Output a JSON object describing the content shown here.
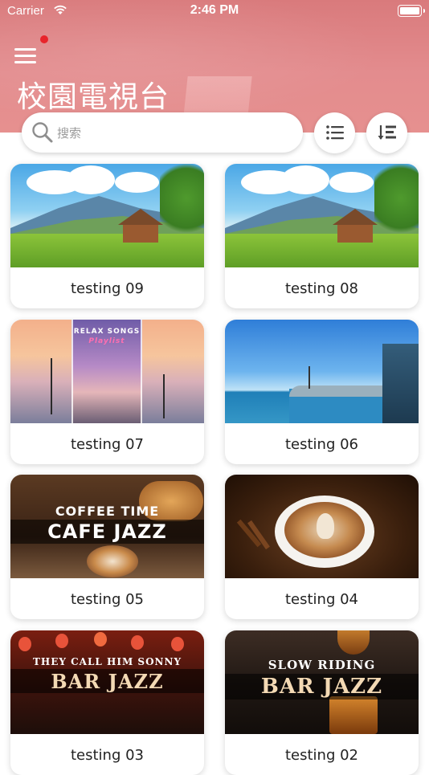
{
  "status_bar": {
    "carrier": "Carrier",
    "time": "2:46 PM"
  },
  "header": {
    "title": "校園電視台",
    "has_notification": true
  },
  "search": {
    "placeholder": "搜索",
    "value": ""
  },
  "toolbar": {
    "list_view_icon": "list-icon",
    "sort_icon": "sort-icon"
  },
  "videos": [
    {
      "label": "testing 09",
      "thumbnail": "countryside-house"
    },
    {
      "label": "testing 08",
      "thumbnail": "countryside-house"
    },
    {
      "label": "testing 07",
      "thumbnail": "relax-songs-sunset"
    },
    {
      "label": "testing 06",
      "thumbnail": "seaside"
    },
    {
      "label": "testing 05",
      "thumbnail": "cafe-jazz"
    },
    {
      "label": "testing 04",
      "thumbnail": "latte-art"
    },
    {
      "label": "testing 03",
      "thumbnail": "bar-jazz-lanterns"
    },
    {
      "label": "testing 02",
      "thumbnail": "bar-jazz-whiskey"
    }
  ],
  "thumbnail_text": {
    "relax_title": "RELAX SONGS",
    "relax_subtitle": "Playlist",
    "cafe_top": "COFFEE TIME",
    "cafe_main": "CAFE JAZZ",
    "bar1_top": "THEY CALL HIM SONNY",
    "bar1_main": "BAR JAZZ",
    "bar2_top": "SLOW RIDING",
    "bar2_main": "BAR JAZZ"
  },
  "colors": {
    "header": "#e38c8e",
    "notification_dot": "#e8242b"
  }
}
